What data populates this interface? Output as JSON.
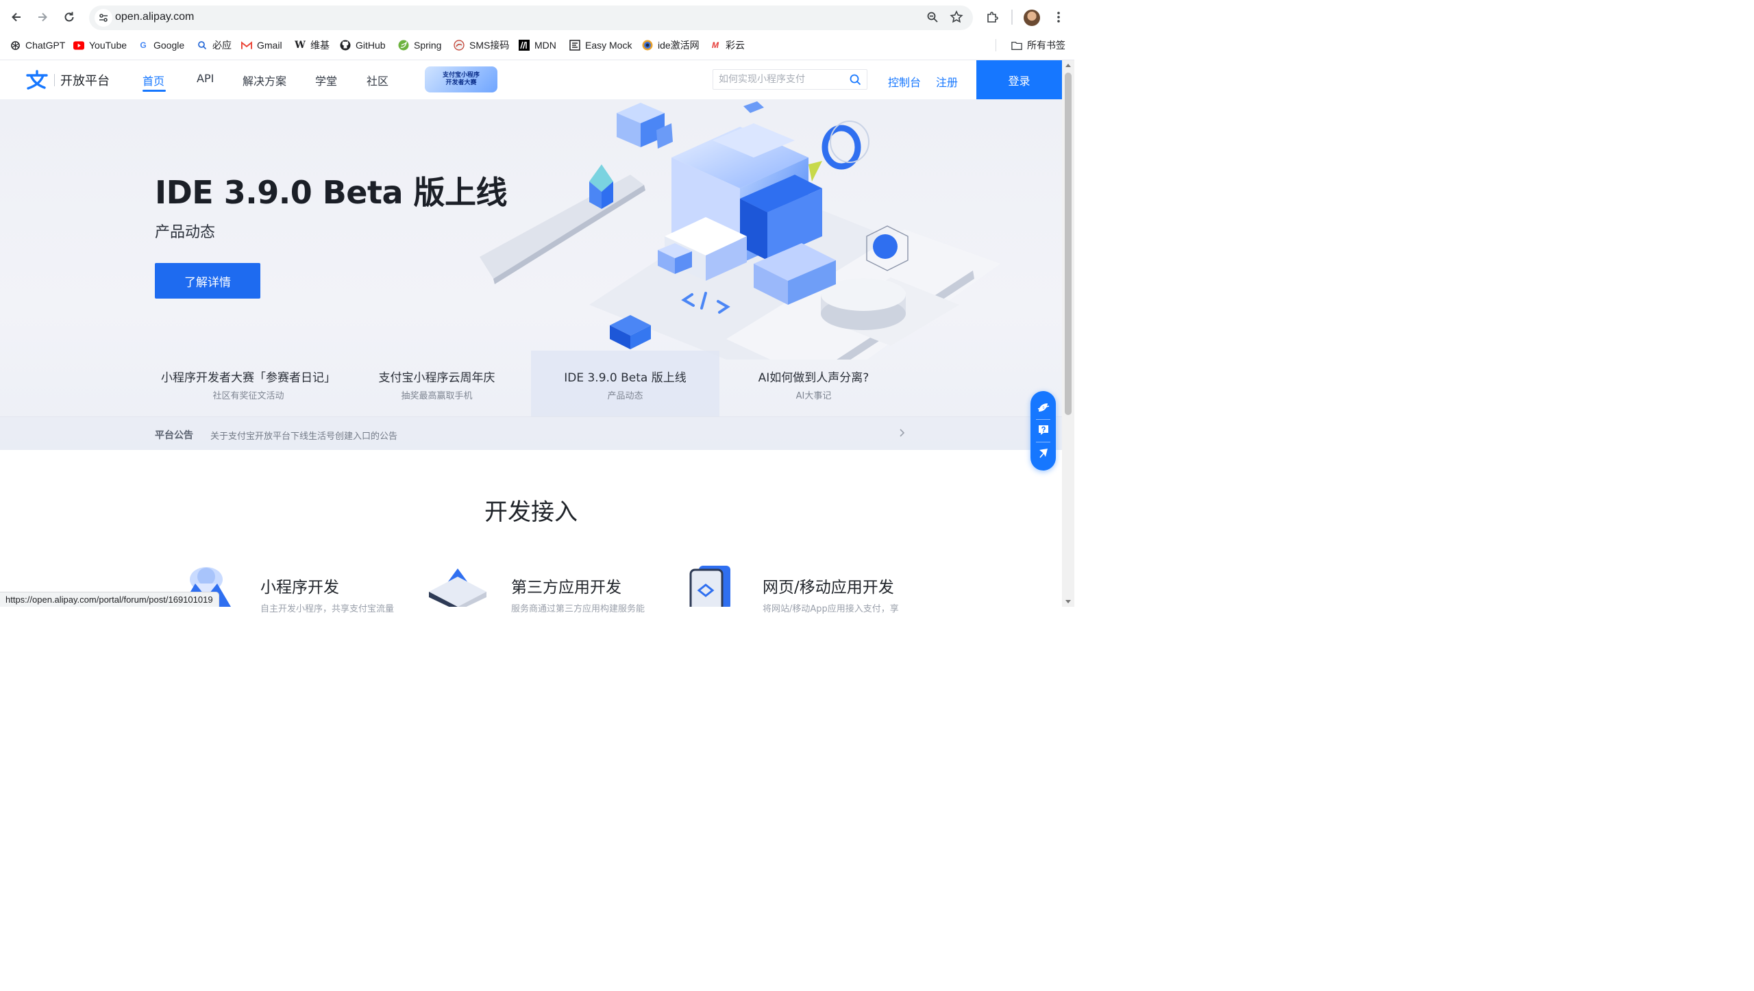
{
  "browser": {
    "url": "open.alipay.com",
    "status_url": "https://open.alipay.com/portal/forum/post/169101019",
    "bookmarks": [
      {
        "label": "ChatGPT",
        "icon": "chatgpt-icon"
      },
      {
        "label": "YouTube",
        "icon": "youtube-icon"
      },
      {
        "label": "Google",
        "icon": "google-icon"
      },
      {
        "label": "必应",
        "icon": "bing-icon"
      },
      {
        "label": "Gmail",
        "icon": "gmail-icon"
      },
      {
        "label": "维基",
        "icon": "wikipedia-icon"
      },
      {
        "label": "GitHub",
        "icon": "github-icon"
      },
      {
        "label": "Spring",
        "icon": "spring-icon"
      },
      {
        "label": "SMS接码",
        "icon": "sms-icon"
      },
      {
        "label": "MDN",
        "icon": "mdn-icon"
      },
      {
        "label": "Easy Mock",
        "icon": "easymock-icon"
      },
      {
        "label": "ide激活网",
        "icon": "ide-icon"
      },
      {
        "label": "彩云",
        "icon": "caiyun-icon"
      }
    ],
    "all_bookmarks_label": "所有书签"
  },
  "site": {
    "logo_text": "开放平台",
    "nav": [
      {
        "label": "首页",
        "active": true
      },
      {
        "label": "API",
        "active": false
      },
      {
        "label": "解决方案",
        "active": false
      },
      {
        "label": "学堂",
        "active": false
      },
      {
        "label": "社区",
        "active": false
      }
    ],
    "promo_badge_line1": "支付宝小程序",
    "promo_badge_line2": "开发者大赛",
    "search_placeholder": "如何实现小程序支付",
    "console_label": "控制台",
    "register_label": "注册",
    "login_label": "登录"
  },
  "hero": {
    "title": "IDE 3.9.0 Beta 版上线",
    "subtitle": "产品动态",
    "cta_label": "了解详情",
    "feature_tabs": [
      {
        "title": "小程序开发者大赛「参赛者日记」",
        "sub": "社区有奖征文活动",
        "active": false
      },
      {
        "title": "支付宝小程序云周年庆",
        "sub": "抽奖最高赢取手机",
        "active": false
      },
      {
        "title": "IDE 3.9.0 Beta 版上线",
        "sub": "产品动态",
        "active": true
      },
      {
        "title": "AI如何做到人声分离?",
        "sub": "AI大事记",
        "active": false
      }
    ],
    "announcement_label": "平台公告",
    "announcement_text": "关于支付宝开放平台下线生活号创建入口的公告"
  },
  "dev_section": {
    "title": "开发接入",
    "cards": [
      {
        "title": "小程序开发",
        "desc": "自主开发小程序，共享支付宝流量"
      },
      {
        "title": "第三方应用开发",
        "desc": "服务商通过第三方应用构建服务能"
      },
      {
        "title": "网页/移动应用开发",
        "desc": "将网站/移动App应用接入支付，享"
      }
    ]
  },
  "colors": {
    "brand_blue": "#1677ff",
    "cta_blue": "#1e6bf0"
  }
}
